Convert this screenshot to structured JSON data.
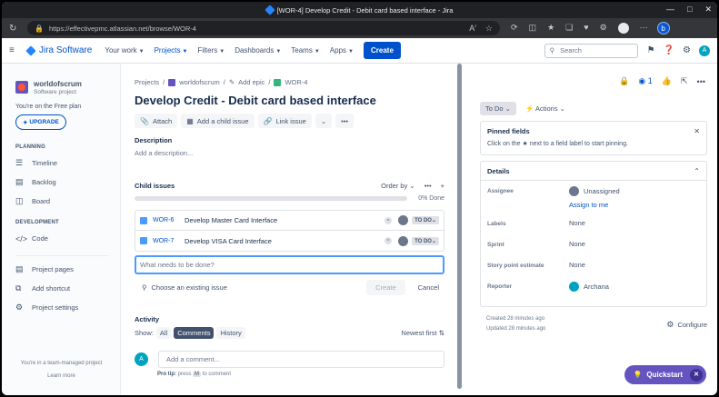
{
  "browser": {
    "tab_title": "[WOR-4] Develop Credit - Debit card based interface - Jira",
    "url": "https://effectivepmc.atlassian.net/browse/WOR-4"
  },
  "topnav": {
    "product": "Jira Software",
    "items": [
      {
        "label": "Your work"
      },
      {
        "label": "Projects"
      },
      {
        "label": "Filters"
      },
      {
        "label": "Dashboards"
      },
      {
        "label": "Teams"
      },
      {
        "label": "Apps"
      }
    ],
    "create_label": "Create",
    "search_placeholder": "Search",
    "user_initial": "A"
  },
  "sidebar": {
    "project_name": "worldofscrum",
    "project_type": "Software project",
    "plan_text": "You're on the Free plan",
    "upgrade_label": "UPGRADE",
    "planning_header": "PLANNING",
    "planning_items": [
      {
        "label": "Timeline",
        "icon": "timeline-icon"
      },
      {
        "label": "Backlog",
        "icon": "backlog-icon"
      },
      {
        "label": "Board",
        "icon": "board-icon"
      }
    ],
    "development_header": "DEVELOPMENT",
    "development_items": [
      {
        "label": "Code",
        "icon": "code-icon"
      }
    ],
    "other_items": [
      {
        "label": "Project pages",
        "icon": "pages-icon"
      },
      {
        "label": "Add shortcut",
        "icon": "shortcut-icon"
      },
      {
        "label": "Project settings",
        "icon": "gear-icon"
      }
    ],
    "footer_text": "You're in a team-managed project",
    "learn_more": "Learn more"
  },
  "issue": {
    "breadcrumb_projects": "Projects",
    "breadcrumb_project": "worldofscrum",
    "breadcrumb_epic": "Add epic",
    "breadcrumb_key": "WOR-4",
    "title": "Develop Credit - Debit card based interface",
    "actions": {
      "attach": "Attach",
      "add_child": "Add a child issue",
      "link_issue": "Link issue"
    },
    "description_label": "Description",
    "description_placeholder": "Add a description...",
    "child_issues_label": "Child issues",
    "order_by": "Order by",
    "progress_pct": 0,
    "progress_text": "0% Done",
    "children": [
      {
        "key": "WOR-6",
        "summary": "Develop Master Card Interface",
        "status": "TO DO"
      },
      {
        "key": "WOR-7",
        "summary": "Develop VISA Card Interface",
        "status": "TO DO"
      }
    ],
    "new_child_placeholder": "What needs to be done?",
    "choose_existing": "Choose an existing issue",
    "create_label": "Create",
    "cancel_label": "Cancel",
    "activity_label": "Activity",
    "show_label": "Show:",
    "activity_tabs": [
      "All",
      "Comments",
      "History"
    ],
    "activity_selected": "Comments",
    "sort_label": "Newest first",
    "comment_placeholder": "Add a comment...",
    "protip_bold": "Pro tip:",
    "protip_press": "press",
    "protip_key": "M",
    "protip_tail": "to comment"
  },
  "right": {
    "watch_count": "1",
    "status": "To Do",
    "actions_label": "Actions",
    "pinned_title": "Pinned fields",
    "pinned_text": "Click on the ★ next to a field label to start pinning.",
    "details_title": "Details",
    "fields": {
      "assignee_label": "Assignee",
      "assignee_value": "Unassigned",
      "assign_to_me": "Assign to me",
      "labels_label": "Labels",
      "labels_value": "None",
      "sprint_label": "Sprint",
      "sprint_value": "None",
      "spe_label": "Story point estimate",
      "spe_value": "None",
      "reporter_label": "Reporter",
      "reporter_value": "Archana"
    },
    "created": "Created 28 minutes ago",
    "updated": "Updated 28 minutes ago",
    "configure": "Configure"
  },
  "quickstart": {
    "label": "Quickstart"
  }
}
